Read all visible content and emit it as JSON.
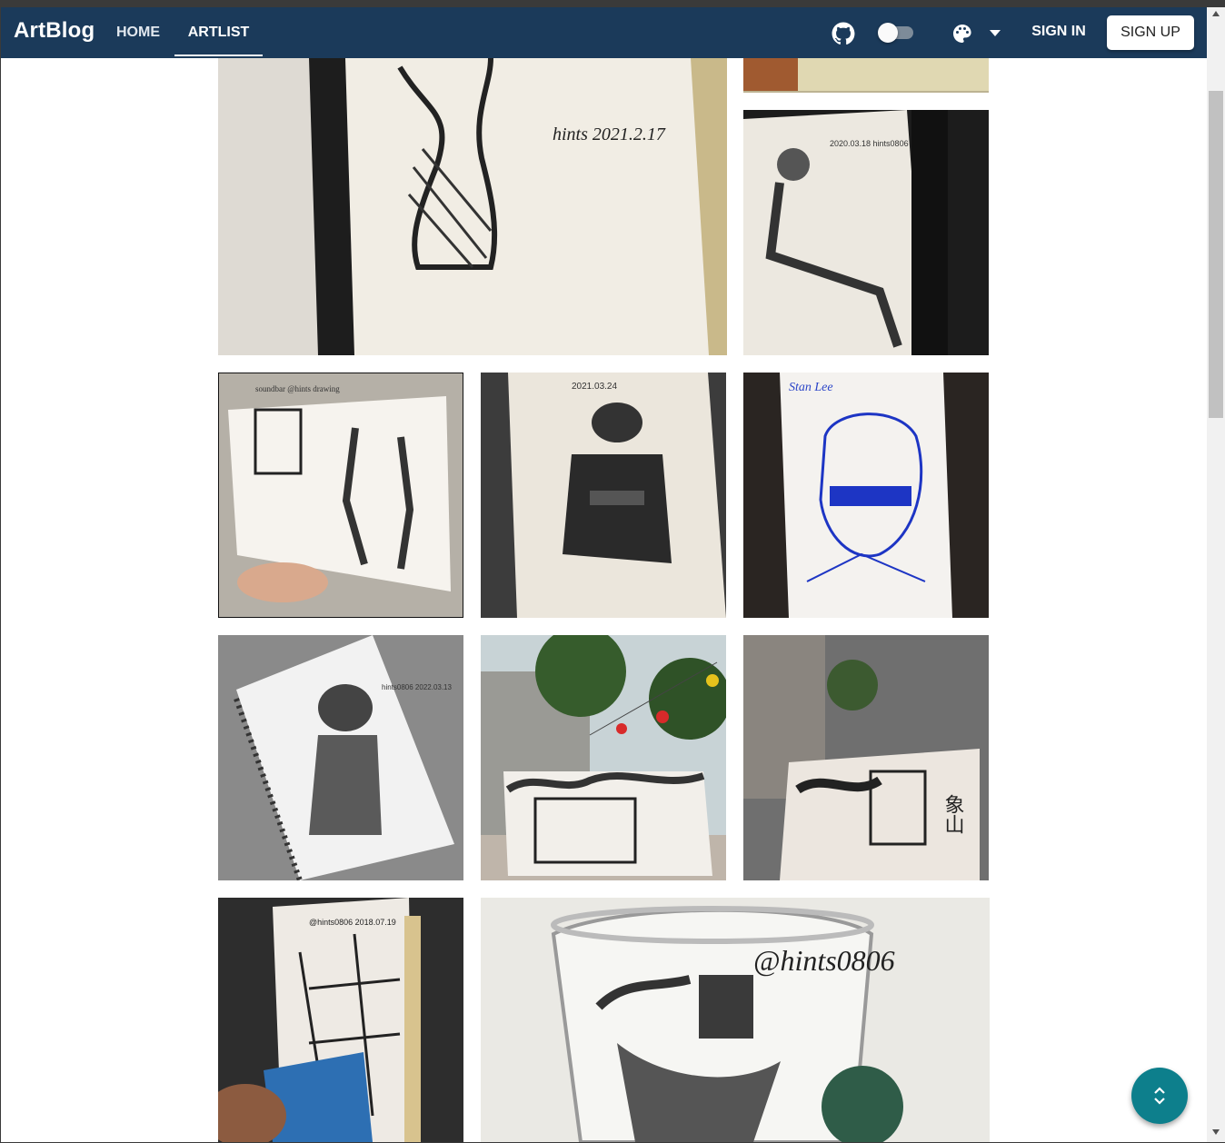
{
  "appbar": {
    "brand": "ArtBlog",
    "nav": [
      {
        "label": "HOME"
      },
      {
        "label": "ARTLIST"
      }
    ],
    "active_tab": "ARTLIST",
    "sign_in": "SIGN IN",
    "sign_up": "SIGN UP",
    "icons": {
      "github": "github-icon",
      "theme_toggle": "theme-toggle",
      "palette": "palette-icon",
      "palette_menu": "chevron-down-icon"
    },
    "color": "#1b3a5a"
  },
  "gallery": {
    "tiles": [
      {
        "caption": "hints 2021.2.17"
      },
      {
        "caption": "2020.03.18 hints0806"
      },
      {
        "caption": "soundbar  @hints  drawing"
      },
      {
        "caption": "2021.03.24"
      },
      {
        "caption": "Stan Lee"
      },
      {
        "caption": "hints0806 2022.03.13"
      },
      {
        "caption": ""
      },
      {
        "caption": "象山"
      },
      {
        "caption": "@hints0806 2018.07.19"
      },
      {
        "caption": "@hints0806"
      }
    ]
  },
  "scroll_button": {
    "icon": "unfold-icon",
    "color": "#0d7f8c"
  }
}
